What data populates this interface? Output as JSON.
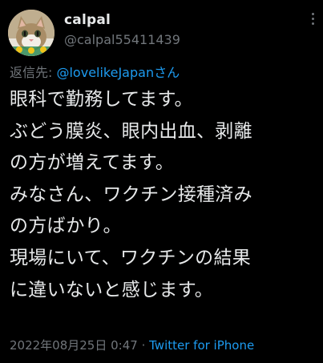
{
  "user": {
    "display_name": "calpal",
    "handle": "@calpal55411439"
  },
  "reply": {
    "prefix": "返信先: ",
    "target": "@lovelikeJapanさん"
  },
  "tweet": {
    "lines": [
      "眼科で勤務してます。",
      "ぶどう膜炎、眼内出血、剥離",
      "の方が増えてます。",
      "みなさん、ワクチン接種済み",
      "の方ばかり。",
      "現場にいて、ワクチンの結果",
      "に違いないと感じます。"
    ]
  },
  "meta": {
    "timestamp": "2022年08月25日 0:47",
    "separator": " · ",
    "source": "Twitter for iPhone"
  },
  "icons": {
    "avatar": "cat-avatar",
    "more": "more-vertical-icon"
  },
  "colors": {
    "background": "#000000",
    "text": "#e7e9ea",
    "secondary": "#71767b",
    "link": "#1d9bf0"
  }
}
